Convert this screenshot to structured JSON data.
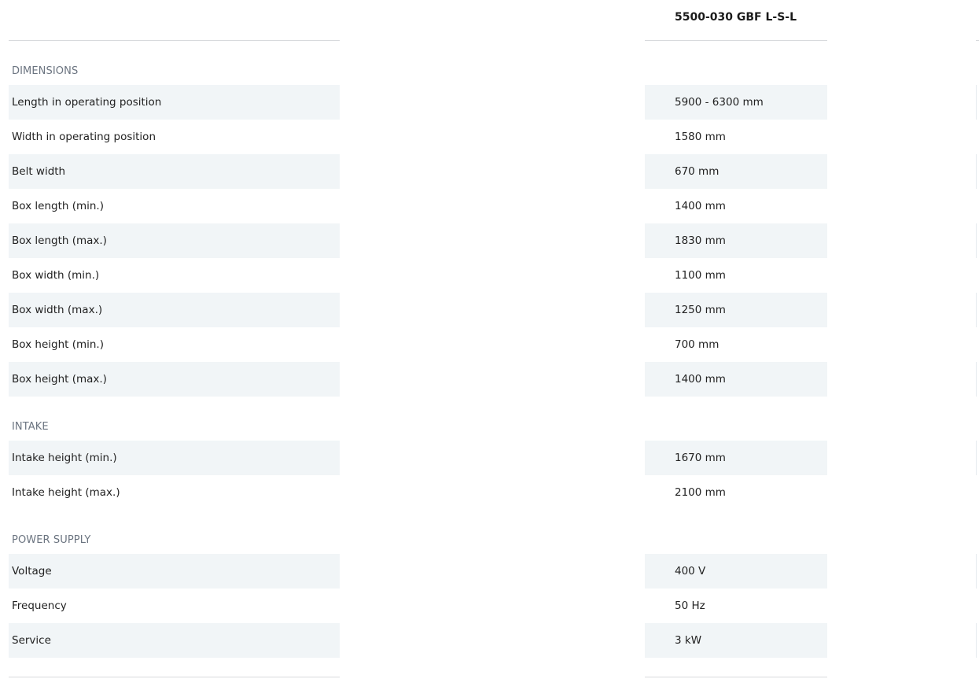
{
  "header": {
    "model_title": "5500-030 GBF L-S-L"
  },
  "sections": [
    {
      "title": "DIMENSIONS",
      "rows": [
        {
          "label": "Length in operating position",
          "value": "5900 - 6300 mm"
        },
        {
          "label": "Width in operating position",
          "value": "1580 mm"
        },
        {
          "label": "Belt width",
          "value": "670 mm"
        },
        {
          "label": "Box length (min.)",
          "value": "1400 mm"
        },
        {
          "label": "Box length (max.)",
          "value": "1830 mm"
        },
        {
          "label": "Box width (min.)",
          "value": "1100 mm"
        },
        {
          "label": "Box width (max.)",
          "value": "1250 mm"
        },
        {
          "label": "Box height (min.)",
          "value": "700 mm"
        },
        {
          "label": "Box height (max.)",
          "value": "1400 mm"
        }
      ]
    },
    {
      "title": "INTAKE",
      "rows": [
        {
          "label": "Intake height (min.)",
          "value": "1670 mm"
        },
        {
          "label": "Intake height (max.)",
          "value": "2100 mm"
        }
      ]
    },
    {
      "title": "POWER SUPPLY",
      "rows": [
        {
          "label": "Voltage",
          "value": "400 V"
        },
        {
          "label": "Frequency",
          "value": "50 Hz"
        },
        {
          "label": "Service",
          "value": "3 kW"
        }
      ]
    }
  ]
}
